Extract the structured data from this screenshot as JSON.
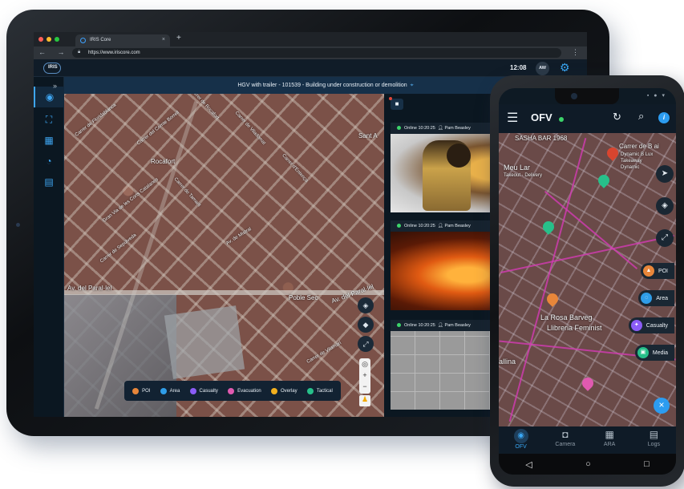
{
  "browser": {
    "tab_title": "IRIS Core",
    "tab_close": "×",
    "new_tab": "+",
    "nav_buttons": "← → C",
    "url": "https://www.iriscore.com",
    "menu": "⋮"
  },
  "header": {
    "logo": "IRIS",
    "time": "12:08",
    "user_initials": "AW",
    "settings_icon": "gear-icon"
  },
  "sidebar": {
    "expand": "»",
    "items": [
      {
        "icon": "globe-icon",
        "glyph": "◉",
        "active": true
      },
      {
        "icon": "hierarchy-icon",
        "glyph": "⛶",
        "active": false
      },
      {
        "icon": "table-icon",
        "glyph": "▦",
        "active": false
      },
      {
        "icon": "timer-icon",
        "glyph": "◔",
        "active": false
      },
      {
        "icon": "report-icon",
        "glyph": "▤",
        "active": false
      }
    ]
  },
  "incident": {
    "title": "HGV with trailer - 101539 - Building under construction or demolition"
  },
  "map": {
    "labels": [
      "Rocafort",
      "Av. del Paral·lel",
      "Poble Sec",
      "Av. del Paral·lel",
      "Sant A",
      "Carrer de Floridablanca",
      "Gran Via de les Corts Catalanes",
      "Carrer de Sepúlveda",
      "Av. de Mistral",
      "Carrer de Tamarit",
      "Carrer de Rocafort",
      "Carrer del Comte Borrell",
      "Carrer de Viladomat",
      "Carrer d'Entença",
      "Carrer de Vilamarí"
    ],
    "controls": {
      "layers": "◈",
      "stack": "◆",
      "expand": "⤢",
      "zoom_in": "+",
      "zoom_out": "−",
      "locate": "◎",
      "pegman": "♟"
    }
  },
  "legend": [
    {
      "label": "POI",
      "color": "#e8863a"
    },
    {
      "label": "Area",
      "color": "#2f9de8"
    },
    {
      "label": "Casualty",
      "color": "#8b5cf6"
    },
    {
      "label": "Evacuation",
      "color": "#e05ab0"
    },
    {
      "label": "Overlay",
      "color": "#f2b01e"
    },
    {
      "label": "Tactical",
      "color": "#27c08a"
    }
  ],
  "cameras": {
    "button_icon": "video-camera-icon",
    "feeds": [
      {
        "status": "Online",
        "time": "10:20:25",
        "user": "Pam Beasley",
        "scene": "firefighter"
      },
      {
        "status": "Online",
        "time": "10:20:25",
        "user": "Pam Beasley",
        "scene": "fire"
      },
      {
        "status": "Online",
        "time": "10:20:25",
        "user": "Pam Beasley",
        "scene": "floor"
      }
    ]
  },
  "phone": {
    "title": "OFV",
    "status_icons": "▪ ● ▾",
    "map_labels": [
      "SASHA BAR 1968",
      "Carrer de B ai",
      "Dynamic B Lux",
      "Takeaway",
      "Dynamic",
      "Meu Lar",
      "Takeout · Delivery",
      "La Rosa Barveg",
      "Llibreria Feminist",
      "allina"
    ],
    "actions": [
      {
        "label": "POI",
        "color": "#e8863a",
        "icon": "poi-icon",
        "glyph": "▲"
      },
      {
        "label": "Area",
        "color": "#2f9de8",
        "icon": "area-icon",
        "glyph": "◌"
      },
      {
        "label": "Casualty",
        "color": "#8b5cf6",
        "icon": "casualty-icon",
        "glyph": "✦"
      },
      {
        "label": "Media",
        "color": "#27c08a",
        "icon": "media-icon",
        "glyph": "▣"
      }
    ],
    "controls": {
      "navigate": "➤",
      "layers": "◈",
      "expand": "⤢",
      "close": "×"
    },
    "nav": [
      {
        "label": "OFV",
        "glyph": "◉",
        "active": true
      },
      {
        "label": "Camera",
        "glyph": "◘",
        "active": false
      },
      {
        "label": "ARA",
        "glyph": "▦",
        "active": false
      },
      {
        "label": "Logs",
        "glyph": "▤",
        "active": false
      }
    ],
    "android": {
      "back": "◁",
      "home": "○",
      "recent": "□"
    }
  }
}
